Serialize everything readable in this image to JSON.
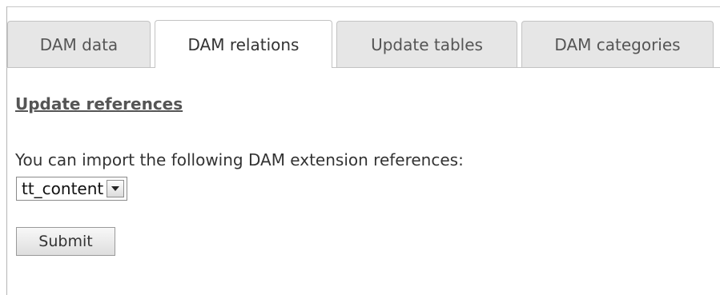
{
  "tabs": [
    {
      "label": "DAM data",
      "active": false
    },
    {
      "label": "DAM relations",
      "active": true
    },
    {
      "label": "Update tables",
      "active": false
    },
    {
      "label": "DAM categories",
      "active": false
    }
  ],
  "section": {
    "title": "Update references",
    "description": "You can import the following DAM extension references:"
  },
  "references_select": {
    "selected": "tt_content",
    "icon": "chevron-down-icon"
  },
  "form": {
    "submit_label": "Submit"
  },
  "colors": {
    "tab_inactive_bg": "#e6e6e6",
    "tab_active_bg": "#ffffff",
    "border": "#c3c3c3",
    "text": "#333333"
  }
}
